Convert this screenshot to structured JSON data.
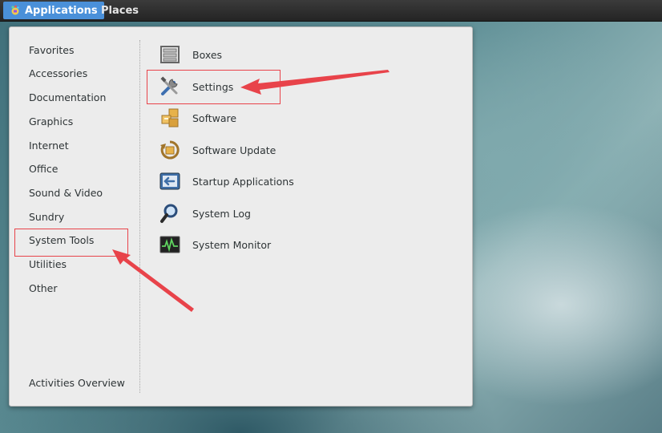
{
  "topbar": {
    "applications_label": "Applications",
    "places_label": "Places"
  },
  "categories": [
    "Favorites",
    "Accessories",
    "Documentation",
    "Graphics",
    "Internet",
    "Office",
    "Sound & Video",
    "Sundry",
    "System Tools",
    "Utilities",
    "Other"
  ],
  "activities_label": "Activities Overview",
  "apps": [
    {
      "label": "Boxes",
      "icon": "boxes-icon"
    },
    {
      "label": "Settings",
      "icon": "settings-tools-icon"
    },
    {
      "label": "Software",
      "icon": "software-packages-icon"
    },
    {
      "label": "Software Update",
      "icon": "software-update-icon"
    },
    {
      "label": "Startup Applications",
      "icon": "startup-applications-icon"
    },
    {
      "label": "System Log",
      "icon": "system-log-magnifier-icon"
    },
    {
      "label": "System Monitor",
      "icon": "system-monitor-icon"
    }
  ],
  "colors": {
    "accent": "#4a90d9",
    "annotation_red": "#e8434a",
    "menu_bg": "#ececec",
    "topbar_bg": "#2b2b2b"
  }
}
